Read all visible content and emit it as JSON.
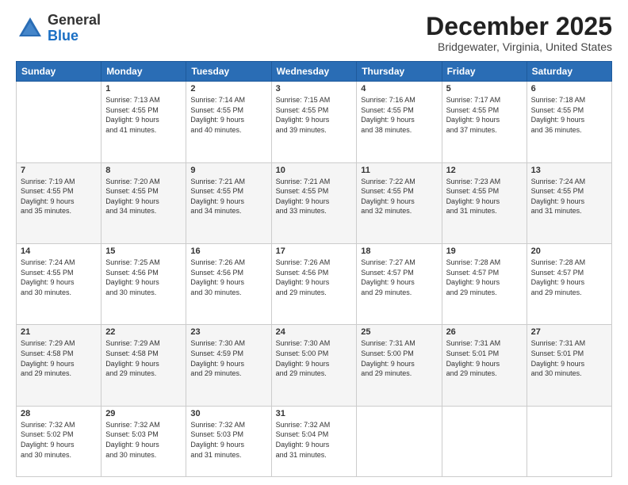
{
  "header": {
    "logo": {
      "general": "General",
      "blue": "Blue"
    },
    "title": "December 2025",
    "location": "Bridgewater, Virginia, United States"
  },
  "calendar": {
    "days_of_week": [
      "Sunday",
      "Monday",
      "Tuesday",
      "Wednesday",
      "Thursday",
      "Friday",
      "Saturday"
    ],
    "weeks": [
      [
        {
          "day": "",
          "info": ""
        },
        {
          "day": "1",
          "info": "Sunrise: 7:13 AM\nSunset: 4:55 PM\nDaylight: 9 hours\nand 41 minutes."
        },
        {
          "day": "2",
          "info": "Sunrise: 7:14 AM\nSunset: 4:55 PM\nDaylight: 9 hours\nand 40 minutes."
        },
        {
          "day": "3",
          "info": "Sunrise: 7:15 AM\nSunset: 4:55 PM\nDaylight: 9 hours\nand 39 minutes."
        },
        {
          "day": "4",
          "info": "Sunrise: 7:16 AM\nSunset: 4:55 PM\nDaylight: 9 hours\nand 38 minutes."
        },
        {
          "day": "5",
          "info": "Sunrise: 7:17 AM\nSunset: 4:55 PM\nDaylight: 9 hours\nand 37 minutes."
        },
        {
          "day": "6",
          "info": "Sunrise: 7:18 AM\nSunset: 4:55 PM\nDaylight: 9 hours\nand 36 minutes."
        }
      ],
      [
        {
          "day": "7",
          "info": "Sunrise: 7:19 AM\nSunset: 4:55 PM\nDaylight: 9 hours\nand 35 minutes."
        },
        {
          "day": "8",
          "info": "Sunrise: 7:20 AM\nSunset: 4:55 PM\nDaylight: 9 hours\nand 34 minutes."
        },
        {
          "day": "9",
          "info": "Sunrise: 7:21 AM\nSunset: 4:55 PM\nDaylight: 9 hours\nand 34 minutes."
        },
        {
          "day": "10",
          "info": "Sunrise: 7:21 AM\nSunset: 4:55 PM\nDaylight: 9 hours\nand 33 minutes."
        },
        {
          "day": "11",
          "info": "Sunrise: 7:22 AM\nSunset: 4:55 PM\nDaylight: 9 hours\nand 32 minutes."
        },
        {
          "day": "12",
          "info": "Sunrise: 7:23 AM\nSunset: 4:55 PM\nDaylight: 9 hours\nand 31 minutes."
        },
        {
          "day": "13",
          "info": "Sunrise: 7:24 AM\nSunset: 4:55 PM\nDaylight: 9 hours\nand 31 minutes."
        }
      ],
      [
        {
          "day": "14",
          "info": "Sunrise: 7:24 AM\nSunset: 4:55 PM\nDaylight: 9 hours\nand 30 minutes."
        },
        {
          "day": "15",
          "info": "Sunrise: 7:25 AM\nSunset: 4:56 PM\nDaylight: 9 hours\nand 30 minutes."
        },
        {
          "day": "16",
          "info": "Sunrise: 7:26 AM\nSunset: 4:56 PM\nDaylight: 9 hours\nand 30 minutes."
        },
        {
          "day": "17",
          "info": "Sunrise: 7:26 AM\nSunset: 4:56 PM\nDaylight: 9 hours\nand 29 minutes."
        },
        {
          "day": "18",
          "info": "Sunrise: 7:27 AM\nSunset: 4:57 PM\nDaylight: 9 hours\nand 29 minutes."
        },
        {
          "day": "19",
          "info": "Sunrise: 7:28 AM\nSunset: 4:57 PM\nDaylight: 9 hours\nand 29 minutes."
        },
        {
          "day": "20",
          "info": "Sunrise: 7:28 AM\nSunset: 4:57 PM\nDaylight: 9 hours\nand 29 minutes."
        }
      ],
      [
        {
          "day": "21",
          "info": "Sunrise: 7:29 AM\nSunset: 4:58 PM\nDaylight: 9 hours\nand 29 minutes."
        },
        {
          "day": "22",
          "info": "Sunrise: 7:29 AM\nSunset: 4:58 PM\nDaylight: 9 hours\nand 29 minutes."
        },
        {
          "day": "23",
          "info": "Sunrise: 7:30 AM\nSunset: 4:59 PM\nDaylight: 9 hours\nand 29 minutes."
        },
        {
          "day": "24",
          "info": "Sunrise: 7:30 AM\nSunset: 5:00 PM\nDaylight: 9 hours\nand 29 minutes."
        },
        {
          "day": "25",
          "info": "Sunrise: 7:31 AM\nSunset: 5:00 PM\nDaylight: 9 hours\nand 29 minutes."
        },
        {
          "day": "26",
          "info": "Sunrise: 7:31 AM\nSunset: 5:01 PM\nDaylight: 9 hours\nand 29 minutes."
        },
        {
          "day": "27",
          "info": "Sunrise: 7:31 AM\nSunset: 5:01 PM\nDaylight: 9 hours\nand 30 minutes."
        }
      ],
      [
        {
          "day": "28",
          "info": "Sunrise: 7:32 AM\nSunset: 5:02 PM\nDaylight: 9 hours\nand 30 minutes."
        },
        {
          "day": "29",
          "info": "Sunrise: 7:32 AM\nSunset: 5:03 PM\nDaylight: 9 hours\nand 30 minutes."
        },
        {
          "day": "30",
          "info": "Sunrise: 7:32 AM\nSunset: 5:03 PM\nDaylight: 9 hours\nand 31 minutes."
        },
        {
          "day": "31",
          "info": "Sunrise: 7:32 AM\nSunset: 5:04 PM\nDaylight: 9 hours\nand 31 minutes."
        },
        {
          "day": "",
          "info": ""
        },
        {
          "day": "",
          "info": ""
        },
        {
          "day": "",
          "info": ""
        }
      ]
    ]
  }
}
